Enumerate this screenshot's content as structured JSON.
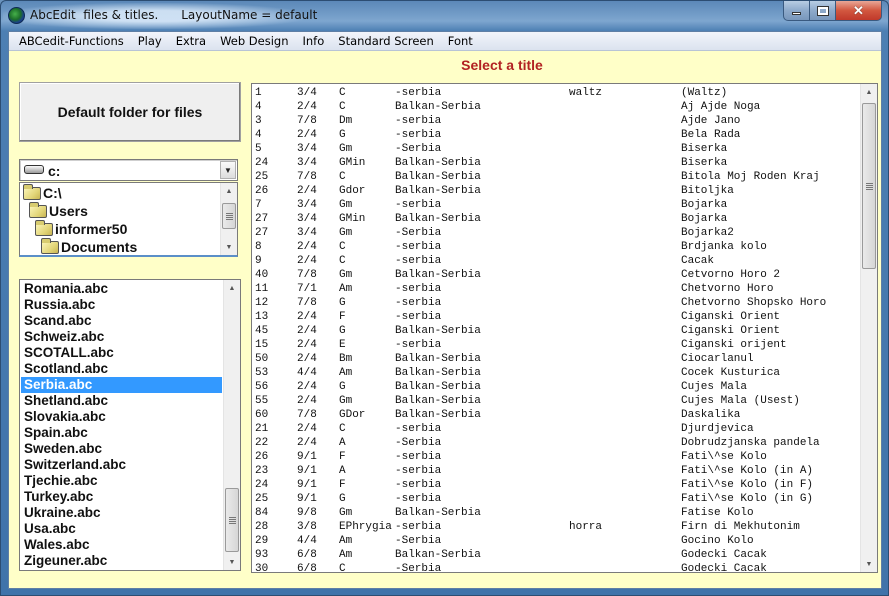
{
  "window": {
    "title": "AbcEdit  files & titles.      LayoutName = default",
    "minimize_label": "minimize",
    "maximize_label": "maximize",
    "close_label": "close"
  },
  "menu": {
    "items": [
      {
        "label": "ABCedit-Functions"
      },
      {
        "label": "Play"
      },
      {
        "label": "Extra"
      },
      {
        "label": "Web Design"
      },
      {
        "label": "Info"
      },
      {
        "label": "Standard Screen"
      },
      {
        "label": "Font"
      }
    ]
  },
  "header": {
    "select_title": "Select a title"
  },
  "left_panel": {
    "default_folder_button": "Default folder for files",
    "drive": {
      "value": "c:",
      "icon": "drive-icon"
    },
    "directories": [
      {
        "label": "C:\\",
        "indent": 0
      },
      {
        "label": "Users",
        "indent": 1
      },
      {
        "label": "informer50",
        "indent": 2
      },
      {
        "label": "Documents",
        "indent": 3
      }
    ],
    "files": [
      {
        "label": "Romania.abc"
      },
      {
        "label": "Russia.abc"
      },
      {
        "label": "Scand.abc"
      },
      {
        "label": "Schweiz.abc"
      },
      {
        "label": "SCOTALL.abc"
      },
      {
        "label": "Scotland.abc"
      },
      {
        "label": "Serbia.abc",
        "selected": true
      },
      {
        "label": "Shetland.abc"
      },
      {
        "label": "Slovakia.abc"
      },
      {
        "label": "Spain.abc"
      },
      {
        "label": "Sweden.abc"
      },
      {
        "label": "Switzerland.abc"
      },
      {
        "label": "Tjechie.abc"
      },
      {
        "label": "Turkey.abc"
      },
      {
        "label": "Ukraine.abc"
      },
      {
        "label": "Usa.abc"
      },
      {
        "label": "Wales.abc"
      },
      {
        "label": "Zigeuner.abc"
      }
    ],
    "selected_file": "Serbia.abc"
  },
  "titles": {
    "rows": [
      {
        "num": "1",
        "meter": "3/4",
        "key": "C",
        "area": "-serbia",
        "rhythm": "waltz",
        "title": "(Waltz)"
      },
      {
        "num": "4",
        "meter": "2/4",
        "key": "C",
        "area": "Balkan-Serbia",
        "rhythm": "",
        "title": "Aj Ajde Noga"
      },
      {
        "num": "3",
        "meter": "7/8",
        "key": "Dm",
        "area": "-serbia",
        "rhythm": "",
        "title": "Ajde Jano"
      },
      {
        "num": "4",
        "meter": "2/4",
        "key": "G",
        "area": "-serbia",
        "rhythm": "",
        "title": "Bela Rada"
      },
      {
        "num": "5",
        "meter": "3/4",
        "key": "Gm",
        "area": "-Serbia",
        "rhythm": "",
        "title": "Biserka"
      },
      {
        "num": "24",
        "meter": "3/4",
        "key": "GMin",
        "area": "Balkan-Serbia",
        "rhythm": "",
        "title": "Biserka"
      },
      {
        "num": "25",
        "meter": "7/8",
        "key": "C",
        "area": "Balkan-Serbia",
        "rhythm": "",
        "title": "Bitola Moj Roden Kraj"
      },
      {
        "num": "26",
        "meter": "2/4",
        "key": "Gdor",
        "area": "Balkan-Serbia",
        "rhythm": "",
        "title": "Bitoljka"
      },
      {
        "num": "7",
        "meter": "3/4",
        "key": "Gm",
        "area": "-serbia",
        "rhythm": "",
        "title": "Bojarka"
      },
      {
        "num": "27",
        "meter": "3/4",
        "key": "GMin",
        "area": "Balkan-Serbia",
        "rhythm": "",
        "title": "Bojarka"
      },
      {
        "num": "27",
        "meter": "3/4",
        "key": "Gm",
        "area": "-Serbia",
        "rhythm": "",
        "title": "Bojarka2"
      },
      {
        "num": "8",
        "meter": "2/4",
        "key": "C",
        "area": "-serbia",
        "rhythm": "",
        "title": "Brdjanka kolo"
      },
      {
        "num": "9",
        "meter": "2/4",
        "key": "C",
        "area": "-serbia",
        "rhythm": "",
        "title": "Cacak"
      },
      {
        "num": "40",
        "meter": "7/8",
        "key": "Gm",
        "area": "Balkan-Serbia",
        "rhythm": "",
        "title": "Cetvorno Horo 2"
      },
      {
        "num": "11",
        "meter": "7/1",
        "key": "Am",
        "area": "-serbia",
        "rhythm": "",
        "title": "Chetvorno Horo"
      },
      {
        "num": "12",
        "meter": "7/8",
        "key": "G",
        "area": "-serbia",
        "rhythm": "",
        "title": "Chetvorno Shopsko Horo"
      },
      {
        "num": "13",
        "meter": "2/4",
        "key": "F",
        "area": "-serbia",
        "rhythm": "",
        "title": "Ciganski Orient"
      },
      {
        "num": "45",
        "meter": "2/4",
        "key": "G",
        "area": "Balkan-Serbia",
        "rhythm": "",
        "title": "Ciganski Orient"
      },
      {
        "num": "15",
        "meter": "2/4",
        "key": "E",
        "area": "-serbia",
        "rhythm": "",
        "title": "Ciganski orijent"
      },
      {
        "num": "50",
        "meter": "2/4",
        "key": "Bm",
        "area": "Balkan-Serbia",
        "rhythm": "",
        "title": "Ciocarlanul"
      },
      {
        "num": "53",
        "meter": "4/4",
        "key": "Am",
        "area": "Balkan-Serbia",
        "rhythm": "",
        "title": "Cocek Kusturica"
      },
      {
        "num": "56",
        "meter": "2/4",
        "key": "G",
        "area": "Balkan-Serbia",
        "rhythm": "",
        "title": "Cujes Mala"
      },
      {
        "num": "55",
        "meter": "2/4",
        "key": "Gm",
        "area": "Balkan-Serbia",
        "rhythm": "",
        "title": "Cujes Mala (Usest)"
      },
      {
        "num": "60",
        "meter": "7/8",
        "key": "GDor",
        "area": "Balkan-Serbia",
        "rhythm": "",
        "title": "Daskalika"
      },
      {
        "num": "21",
        "meter": "2/4",
        "key": "C",
        "area": "-serbia",
        "rhythm": "",
        "title": "Djurdjevica"
      },
      {
        "num": "22",
        "meter": "2/4",
        "key": "A",
        "area": "-Serbia",
        "rhythm": "",
        "title": "Dobrudzjanska pandela"
      },
      {
        "num": "26",
        "meter": "9/1",
        "key": "F",
        "area": "-serbia",
        "rhythm": "",
        "title": "Fati\\^se Kolo"
      },
      {
        "num": "23",
        "meter": "9/1",
        "key": "A",
        "area": "-serbia",
        "rhythm": "",
        "title": "Fati\\^se Kolo (in A)"
      },
      {
        "num": "24",
        "meter": "9/1",
        "key": "F",
        "area": "-serbia",
        "rhythm": "",
        "title": "Fati\\^se Kolo (in F)"
      },
      {
        "num": "25",
        "meter": "9/1",
        "key": "G",
        "area": "-serbia",
        "rhythm": "",
        "title": "Fati\\^se Kolo (in G)"
      },
      {
        "num": "84",
        "meter": "9/8",
        "key": "Gm",
        "area": "Balkan-Serbia",
        "rhythm": "",
        "title": "Fatise Kolo"
      },
      {
        "num": "28",
        "meter": "3/8",
        "key": "EPhrygia",
        "area": "-serbia",
        "rhythm": "horra",
        "title": "Firn di Mekhutonim"
      },
      {
        "num": "29",
        "meter": "4/4",
        "key": "Am",
        "area": "-Serbia",
        "rhythm": "",
        "title": "Gocino Kolo"
      },
      {
        "num": "93",
        "meter": "6/8",
        "key": "Am",
        "area": "Balkan-Serbia",
        "rhythm": "",
        "title": "Godecki Cacak"
      },
      {
        "num": "30",
        "meter": "6/8",
        "key": "C",
        "area": "-Serbia",
        "rhythm": "",
        "title": "Godecki Cacak"
      }
    ]
  },
  "scrollbars": {
    "directories": {
      "position_fraction": 0.35
    },
    "files": {
      "position_fraction": 0.85
    },
    "titles": {
      "position_fraction": 0.0
    }
  }
}
